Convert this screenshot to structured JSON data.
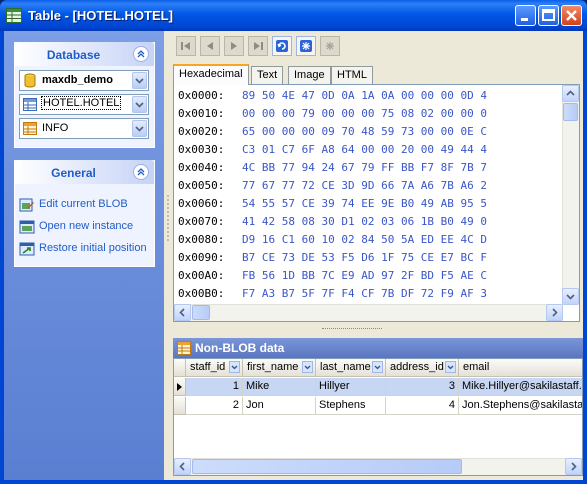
{
  "window": {
    "title": "Table - [HOTEL.HOTEL]"
  },
  "left_pane": {
    "database_group": {
      "title": "Database",
      "database_combo": "maxdb_demo",
      "table_combo": "HOTEL.HOTEL",
      "view_combo": "INFO"
    },
    "general_group": {
      "title": "General",
      "links": [
        {
          "label": "Edit current BLOB",
          "icon": "edit-blob-icon"
        },
        {
          "label": "Open new instance",
          "icon": "new-instance-icon"
        },
        {
          "label": "Restore initial position",
          "icon": "restore-position-icon"
        }
      ]
    }
  },
  "toolbar": {
    "buttons": [
      "first-record-icon",
      "prior-record-icon",
      "next-record-icon",
      "last-record-icon",
      "refresh-icon",
      "post-icon",
      "cancel-icon"
    ]
  },
  "tabs": [
    {
      "label": "Hexadecimal",
      "active": true
    },
    {
      "label": "Text",
      "active": false
    },
    {
      "label": "Image",
      "active": false
    },
    {
      "label": "HTML",
      "active": false
    }
  ],
  "hex_view": {
    "lines": [
      {
        "addr": "0x0000:",
        "bytes": "89 50 4E 47 0D 0A 1A 0A 00 00 00 0D 4"
      },
      {
        "addr": "0x0010:",
        "bytes": "00 00 00 79 00 00 00 75 08 02 00 00 0"
      },
      {
        "addr": "0x0020:",
        "bytes": "65 00 00 00 09 70 48 59 73 00 00 0E C"
      },
      {
        "addr": "0x0030:",
        "bytes": "C3 01 C7 6F A8 64 00 00 20 00 49 44 4"
      },
      {
        "addr": "0x0040:",
        "bytes": "4C BB 77 94 24 67 79 FF BB F7 8F 7B 7"
      },
      {
        "addr": "0x0050:",
        "bytes": "77 67 77 72 CE 3D 9D 66 7A A6 7B A6 2"
      },
      {
        "addr": "0x0060:",
        "bytes": "54 55 57 CE 39 74 EE 9E B0 49 AB 95 5"
      },
      {
        "addr": "0x0070:",
        "bytes": "41 42 58 08 30 D1 02 03 06 1B B0 49 0"
      },
      {
        "addr": "0x0080:",
        "bytes": "D9 16 C1 60 10 02 84 50 5A ED EE 4C D"
      },
      {
        "addr": "0x0090:",
        "bytes": "B7 CE 73 DE 53 F5 D6 1F 75 CE E7 BC F"
      },
      {
        "addr": "0x00A0:",
        "bytes": "FB 56 1D BB 7C E9 AD 97 2F BD F5 AE C"
      },
      {
        "addr": "0x00B0:",
        "bytes": "F7 A3 B7 5F 7F F4 CF 7B DF 72 F9 AF 3"
      }
    ]
  },
  "grid": {
    "title": "Non-BLOB data",
    "columns": [
      "staff_id",
      "first_name",
      "last_name",
      "address_id",
      "email"
    ],
    "rows": [
      {
        "staff_id": "1",
        "first_name": "Mike",
        "last_name": "Hillyer",
        "address_id": "3",
        "email": "Mike.Hillyer@sakilastaff.c",
        "selected": true
      },
      {
        "staff_id": "2",
        "first_name": "Jon",
        "last_name": "Stephens",
        "address_id": "4",
        "email": "Jon.Stephens@sakilastaff",
        "selected": false
      }
    ]
  },
  "colors": {
    "titlebar": "#0058e6",
    "nav_pane": "#6d8fdc",
    "link_text": "#215dc6",
    "hex_bytes": "#3a56c8",
    "tab_accent": "#f5a623"
  }
}
